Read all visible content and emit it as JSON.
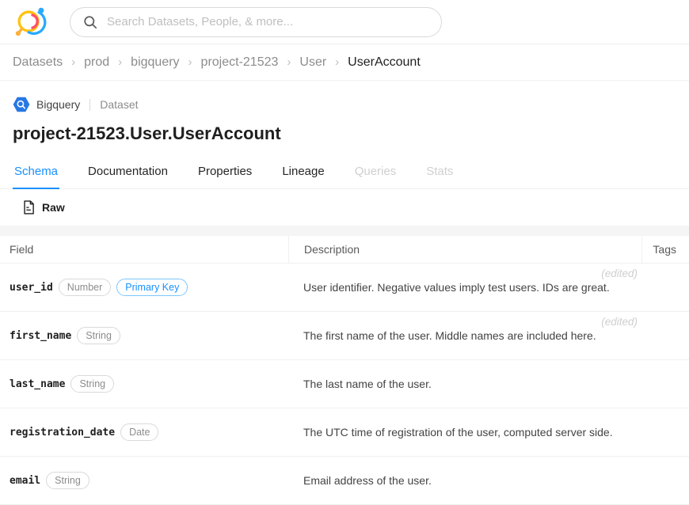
{
  "topbar": {
    "search_placeholder": "Search Datasets, People, & more..."
  },
  "breadcrumb": {
    "separator": "›",
    "items": [
      "Datasets",
      "prod",
      "bigquery",
      "project-21523",
      "User",
      "UserAccount"
    ]
  },
  "entity": {
    "platform": "Bigquery",
    "type": "Dataset",
    "title": "project-21523.User.UserAccount"
  },
  "tabs": [
    {
      "label": "Schema",
      "state": "active"
    },
    {
      "label": "Documentation",
      "state": "default"
    },
    {
      "label": "Properties",
      "state": "default"
    },
    {
      "label": "Lineage",
      "state": "default"
    },
    {
      "label": "Queries",
      "state": "disabled"
    },
    {
      "label": "Stats",
      "state": "disabled"
    }
  ],
  "toolbar": {
    "raw_label": "Raw"
  },
  "schema_table": {
    "columns": [
      "Field",
      "Description",
      "Tags"
    ],
    "rows": [
      {
        "field": "user_id",
        "badges": [
          {
            "label": "Number",
            "variant": "default"
          },
          {
            "label": "Primary Key",
            "variant": "primary"
          }
        ],
        "description": "User identifier. Negative values imply test users. IDs are great.",
        "edited": "(edited)"
      },
      {
        "field": "first_name",
        "badges": [
          {
            "label": "String",
            "variant": "default"
          }
        ],
        "description": "The first name of the user. Middle names are included here.",
        "edited": "(edited)"
      },
      {
        "field": "last_name",
        "badges": [
          {
            "label": "String",
            "variant": "default"
          }
        ],
        "description": "The last name of the user."
      },
      {
        "field": "registration_date",
        "badges": [
          {
            "label": "Date",
            "variant": "default"
          }
        ],
        "description": "The UTC time of registration of the user, computed server side."
      },
      {
        "field": "email",
        "badges": [
          {
            "label": "String",
            "variant": "default"
          }
        ],
        "description": "Email address of the user."
      }
    ]
  },
  "colors": {
    "accent": "#1890ff",
    "badge_primary_border": "#7cc7ff",
    "logo_yellow": "#FFC20E",
    "logo_blue": "#29A9FF",
    "logo_pink": "#FF4E6B",
    "bigquery_blue": "#2878E4"
  }
}
